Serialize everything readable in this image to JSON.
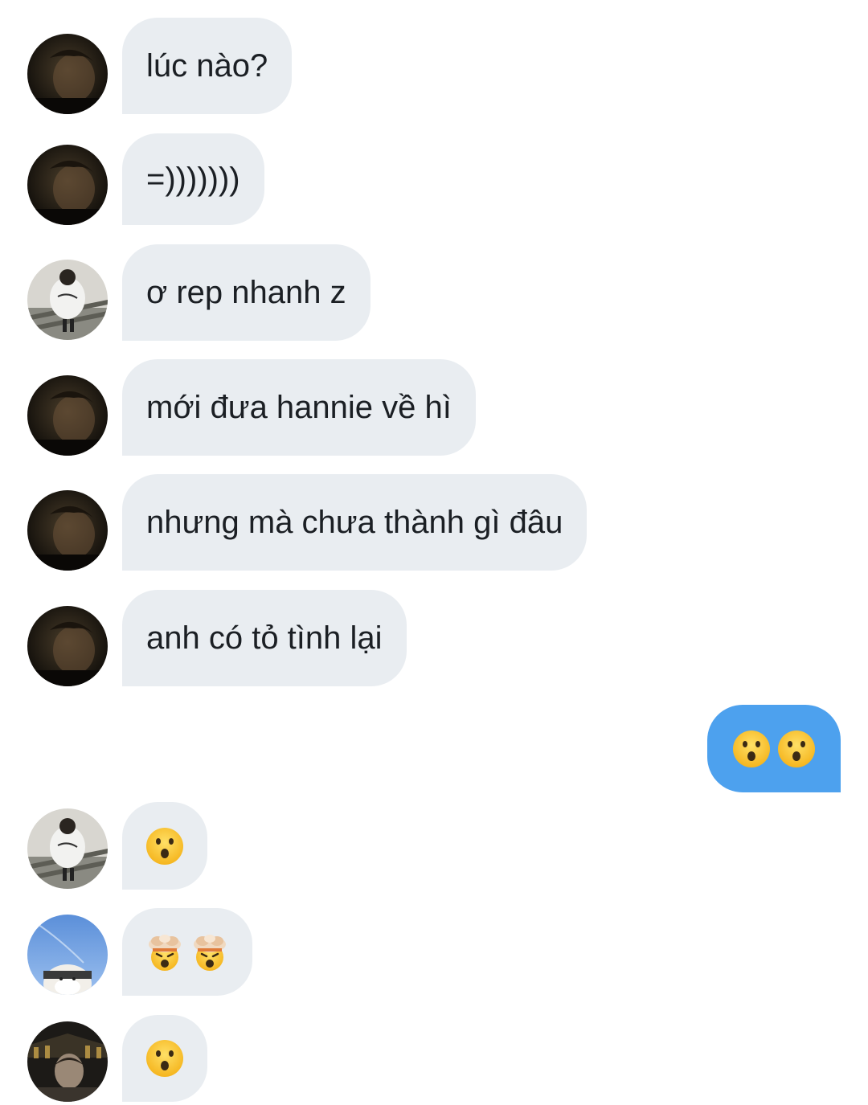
{
  "messages": [
    {
      "sender": "received",
      "avatar": "avatar-dark-boy",
      "text": "lúc nào?"
    },
    {
      "sender": "received",
      "avatar": "avatar-dark-boy",
      "text": "=)))))))"
    },
    {
      "sender": "received",
      "avatar": "avatar-stairs",
      "text": "ơ rep nhanh z"
    },
    {
      "sender": "received",
      "avatar": "avatar-dark-boy",
      "text": "mới đưa hannie về hì"
    },
    {
      "sender": "received",
      "avatar": "avatar-dark-boy",
      "text": "nhưng mà chưa thành gì đâu"
    },
    {
      "sender": "received",
      "avatar": "avatar-dark-boy",
      "text": "anh có tỏ tình lại"
    },
    {
      "sender": "sent",
      "emojis": [
        "hushed-face-emoji",
        "hushed-face-emoji"
      ]
    },
    {
      "sender": "received",
      "avatar": "avatar-stairs",
      "emojis": [
        "hushed-face-emoji"
      ]
    },
    {
      "sender": "received",
      "avatar": "avatar-sky-mask",
      "emojis": [
        "exploding-head-emoji",
        "exploding-head-emoji"
      ]
    },
    {
      "sender": "received",
      "avatar": "avatar-museum",
      "emojis": [
        "hushed-face-emoji"
      ]
    }
  ],
  "colors": {
    "received_bubble": "#e9edf1",
    "sent_bubble": "#4da1ee",
    "text": "#1b1f24"
  }
}
